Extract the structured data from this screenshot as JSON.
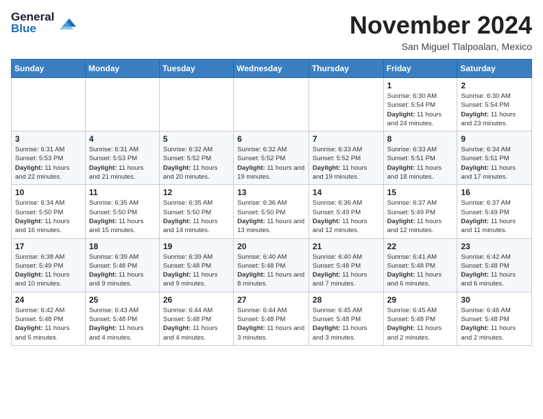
{
  "header": {
    "logo_line1": "General",
    "logo_line2": "Blue",
    "month": "November 2024",
    "location": "San Miguel Tlalpoalan, Mexico"
  },
  "days_of_week": [
    "Sunday",
    "Monday",
    "Tuesday",
    "Wednesday",
    "Thursday",
    "Friday",
    "Saturday"
  ],
  "weeks": [
    [
      {
        "day": "",
        "content": ""
      },
      {
        "day": "",
        "content": ""
      },
      {
        "day": "",
        "content": ""
      },
      {
        "day": "",
        "content": ""
      },
      {
        "day": "",
        "content": ""
      },
      {
        "day": "1",
        "content": "Sunrise: 6:30 AM\nSunset: 5:54 PM\nDaylight: 11 hours and 24 minutes."
      },
      {
        "day": "2",
        "content": "Sunrise: 6:30 AM\nSunset: 5:54 PM\nDaylight: 11 hours and 23 minutes."
      }
    ],
    [
      {
        "day": "3",
        "content": "Sunrise: 6:31 AM\nSunset: 5:53 PM\nDaylight: 11 hours and 22 minutes."
      },
      {
        "day": "4",
        "content": "Sunrise: 6:31 AM\nSunset: 5:53 PM\nDaylight: 11 hours and 21 minutes."
      },
      {
        "day": "5",
        "content": "Sunrise: 6:32 AM\nSunset: 5:52 PM\nDaylight: 11 hours and 20 minutes."
      },
      {
        "day": "6",
        "content": "Sunrise: 6:32 AM\nSunset: 5:52 PM\nDaylight: 11 hours and 19 minutes."
      },
      {
        "day": "7",
        "content": "Sunrise: 6:33 AM\nSunset: 5:52 PM\nDaylight: 11 hours and 19 minutes."
      },
      {
        "day": "8",
        "content": "Sunrise: 6:33 AM\nSunset: 5:51 PM\nDaylight: 11 hours and 18 minutes."
      },
      {
        "day": "9",
        "content": "Sunrise: 6:34 AM\nSunset: 5:51 PM\nDaylight: 11 hours and 17 minutes."
      }
    ],
    [
      {
        "day": "10",
        "content": "Sunrise: 6:34 AM\nSunset: 5:50 PM\nDaylight: 11 hours and 16 minutes."
      },
      {
        "day": "11",
        "content": "Sunrise: 6:35 AM\nSunset: 5:50 PM\nDaylight: 11 hours and 15 minutes."
      },
      {
        "day": "12",
        "content": "Sunrise: 6:35 AM\nSunset: 5:50 PM\nDaylight: 11 hours and 14 minutes."
      },
      {
        "day": "13",
        "content": "Sunrise: 6:36 AM\nSunset: 5:50 PM\nDaylight: 11 hours and 13 minutes."
      },
      {
        "day": "14",
        "content": "Sunrise: 6:36 AM\nSunset: 5:49 PM\nDaylight: 11 hours and 12 minutes."
      },
      {
        "day": "15",
        "content": "Sunrise: 6:37 AM\nSunset: 5:49 PM\nDaylight: 11 hours and 12 minutes."
      },
      {
        "day": "16",
        "content": "Sunrise: 6:37 AM\nSunset: 5:49 PM\nDaylight: 11 hours and 11 minutes."
      }
    ],
    [
      {
        "day": "17",
        "content": "Sunrise: 6:38 AM\nSunset: 5:49 PM\nDaylight: 11 hours and 10 minutes."
      },
      {
        "day": "18",
        "content": "Sunrise: 6:39 AM\nSunset: 5:48 PM\nDaylight: 11 hours and 9 minutes."
      },
      {
        "day": "19",
        "content": "Sunrise: 6:39 AM\nSunset: 5:48 PM\nDaylight: 11 hours and 9 minutes."
      },
      {
        "day": "20",
        "content": "Sunrise: 6:40 AM\nSunset: 5:48 PM\nDaylight: 11 hours and 8 minutes."
      },
      {
        "day": "21",
        "content": "Sunrise: 6:40 AM\nSunset: 5:48 PM\nDaylight: 11 hours and 7 minutes."
      },
      {
        "day": "22",
        "content": "Sunrise: 6:41 AM\nSunset: 5:48 PM\nDaylight: 11 hours and 6 minutes."
      },
      {
        "day": "23",
        "content": "Sunrise: 6:42 AM\nSunset: 5:48 PM\nDaylight: 11 hours and 6 minutes."
      }
    ],
    [
      {
        "day": "24",
        "content": "Sunrise: 6:42 AM\nSunset: 5:48 PM\nDaylight: 11 hours and 5 minutes."
      },
      {
        "day": "25",
        "content": "Sunrise: 6:43 AM\nSunset: 5:48 PM\nDaylight: 11 hours and 4 minutes."
      },
      {
        "day": "26",
        "content": "Sunrise: 6:44 AM\nSunset: 5:48 PM\nDaylight: 11 hours and 4 minutes."
      },
      {
        "day": "27",
        "content": "Sunrise: 6:44 AM\nSunset: 5:48 PM\nDaylight: 11 hours and 3 minutes."
      },
      {
        "day": "28",
        "content": "Sunrise: 6:45 AM\nSunset: 5:48 PM\nDaylight: 11 hours and 3 minutes."
      },
      {
        "day": "29",
        "content": "Sunrise: 6:45 AM\nSunset: 5:48 PM\nDaylight: 11 hours and 2 minutes."
      },
      {
        "day": "30",
        "content": "Sunrise: 6:46 AM\nSunset: 5:48 PM\nDaylight: 11 hours and 2 minutes."
      }
    ]
  ]
}
